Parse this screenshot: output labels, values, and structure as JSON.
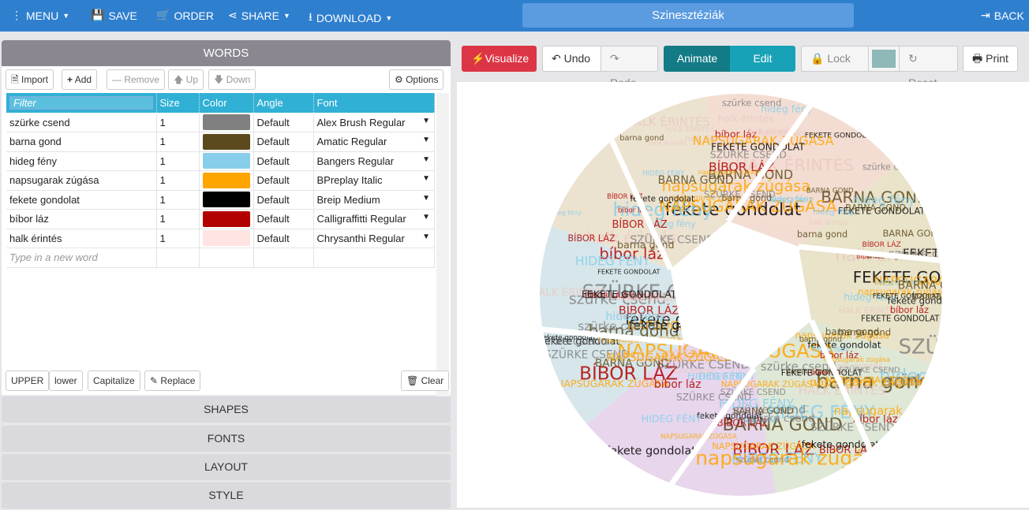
{
  "topbar": {
    "menu": "MENU",
    "save": "SAVE",
    "order": "ORDER",
    "share": "SHARE",
    "download": "DOWNLOAD",
    "title": "Szinesztéziák",
    "back": "BACK"
  },
  "words_panel": {
    "title": "WORDS",
    "import": "Import",
    "add": "Add",
    "remove": "Remove",
    "up": "Up",
    "down": "Down",
    "options": "Options",
    "columns": {
      "filter_placeholder": "Filter",
      "size": "Size",
      "color": "Color",
      "angle": "Angle",
      "font": "Font"
    },
    "rows": [
      {
        "word": "szürke csend",
        "size": "1",
        "color": "#808080",
        "angle": "Default",
        "font": "Alex Brush Regular"
      },
      {
        "word": "barna gond",
        "size": "1",
        "color": "#5c4a1e",
        "angle": "Default",
        "font": "Amatic Regular"
      },
      {
        "word": "hideg fény",
        "size": "1",
        "color": "#87ceeb",
        "angle": "Default",
        "font": "Bangers Regular"
      },
      {
        "word": "napsugarak zúgása",
        "size": "1",
        "color": "#ffa500",
        "angle": "Default",
        "font": "BPreplay Italic"
      },
      {
        "word": "fekete gondolat",
        "size": "1",
        "color": "#000000",
        "angle": "Default",
        "font": "Breip Medium"
      },
      {
        "word": "bíbor láz",
        "size": "1",
        "color": "#b30000",
        "angle": "Default",
        "font": "Calligraffitti Regular"
      },
      {
        "word": "halk érintés",
        "size": "1",
        "color": "#ffe4e1",
        "angle": "Default",
        "font": "Chrysanthi Regular"
      }
    ],
    "new_word_placeholder": "Type in a new word",
    "upper": "UPPER",
    "lower": "lower",
    "capitalize": "Capitalize",
    "replace": "Replace",
    "clear": "Clear"
  },
  "sections": [
    "SHAPES",
    "FONTS",
    "LAYOUT",
    "STYLE"
  ],
  "toolbar": {
    "visualize": "Visualize",
    "undo": "Undo",
    "redo": "Redo",
    "animate": "Animate",
    "edit": "Edit",
    "lock": "Lock",
    "lock_color": "#8fb8b8",
    "reset": "Reset",
    "print": "Print"
  },
  "colors": {
    "accent": "#2f7fcf",
    "visualize": "#dc3545",
    "animate": "#137b85",
    "edit": "#17a2b8",
    "table_header": "#31b0d5"
  }
}
